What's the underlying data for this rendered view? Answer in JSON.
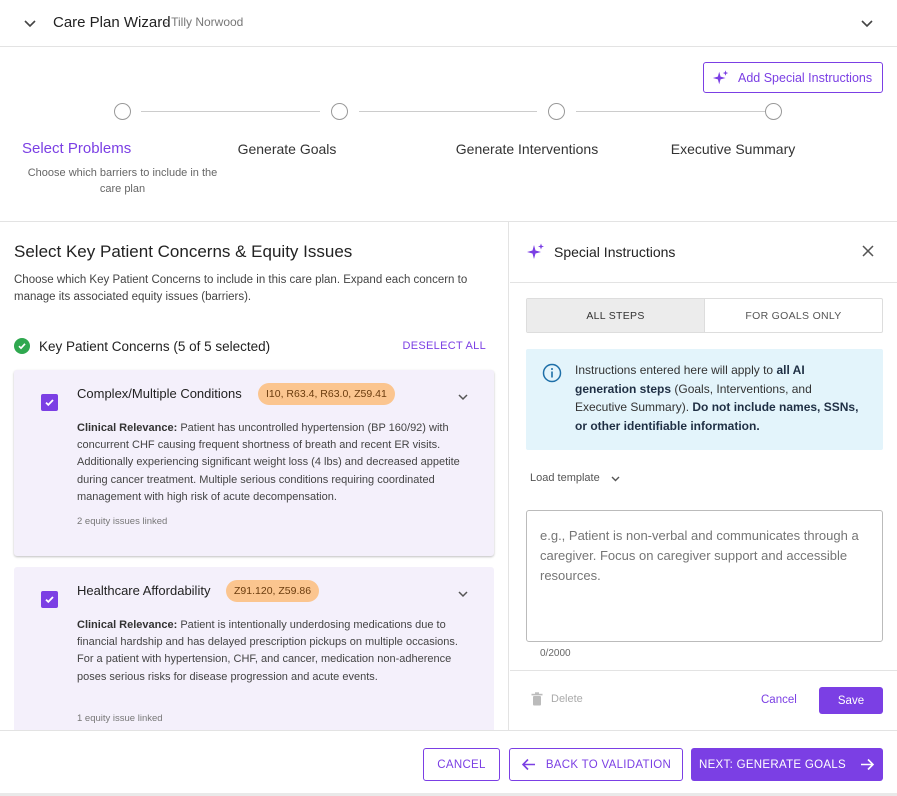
{
  "header": {
    "title": "Care Plan Wizard",
    "patient": "- Tilly Norwood"
  },
  "stepper": {
    "add_special_label": "Add Special Instructions",
    "steps": [
      {
        "label": "Select Problems",
        "desc": "Choose which barriers to include in the care plan",
        "active": true
      },
      {
        "label": "Generate Goals",
        "active": false
      },
      {
        "label": "Generate Interventions",
        "active": false
      },
      {
        "label": "Executive Summary",
        "active": false
      }
    ]
  },
  "left": {
    "title": "Select Key Patient Concerns & Equity Issues",
    "intro": "Choose which Key Patient Concerns to include in this care plan. Expand each concern to manage its associated equity issues (barriers).",
    "kpc_title": "Key Patient Concerns (5 of 5 selected)",
    "deselect_label": "DESELECT ALL",
    "cards": [
      {
        "name": "Complex/Multiple Conditions",
        "codes": "I10, R63.4, R63.0, Z59.41",
        "relevance_label": "Clinical Relevance:",
        "relevance": " Patient has uncontrolled hypertension (BP 160/92) with concurrent CHF causing frequent shortness of breath and recent ER visits. Additionally experiencing significant weight loss (4 lbs) and decreased appetite during cancer treatment. Multiple serious conditions requiring coordinated management with high risk of acute decompensation.",
        "linked": "2 equity issues linked",
        "checked": true
      },
      {
        "name": "Healthcare Affordability",
        "codes": "Z91.120, Z59.86",
        "relevance_label": "Clinical Relevance:",
        "relevance": " Patient is intentionally underdosing medications due to financial hardship and has delayed prescription pickups on multiple occasions. For a patient with hypertension, CHF, and cancer, medication non-adherence poses serious risks for disease progression and acute events.",
        "linked": "1 equity issue linked",
        "checked": true
      }
    ]
  },
  "right": {
    "title": "Special Instructions",
    "tabs": [
      {
        "label": "ALL STEPS",
        "active": true
      },
      {
        "label": "FOR GOALS ONLY",
        "active": false
      }
    ],
    "info": {
      "t1": "Instructions entered here will apply to ",
      "b1": "all AI generation steps",
      "t2": " (Goals, Interventions, and Executive Summary). ",
      "b2": "Do not include names, SSNs, or other identifiable information."
    },
    "load_template_label": "Load template",
    "placeholder": "e.g., Patient is non-verbal and communicates through a caregiver. Focus on caregiver support and accessible resources.",
    "counter": "0/2000",
    "delete_label": "Delete",
    "cancel_label": "Cancel",
    "save_label": "Save"
  },
  "footer": {
    "cancel_label": "CANCEL",
    "back_label": "BACK TO VALIDATION",
    "next_label": "NEXT: GENERATE GOALS"
  },
  "colors": {
    "accent": "#7b3fe4",
    "code_badge": "#fbc58f",
    "info_bg": "#e3f4fb",
    "success": "#2fa84f"
  }
}
